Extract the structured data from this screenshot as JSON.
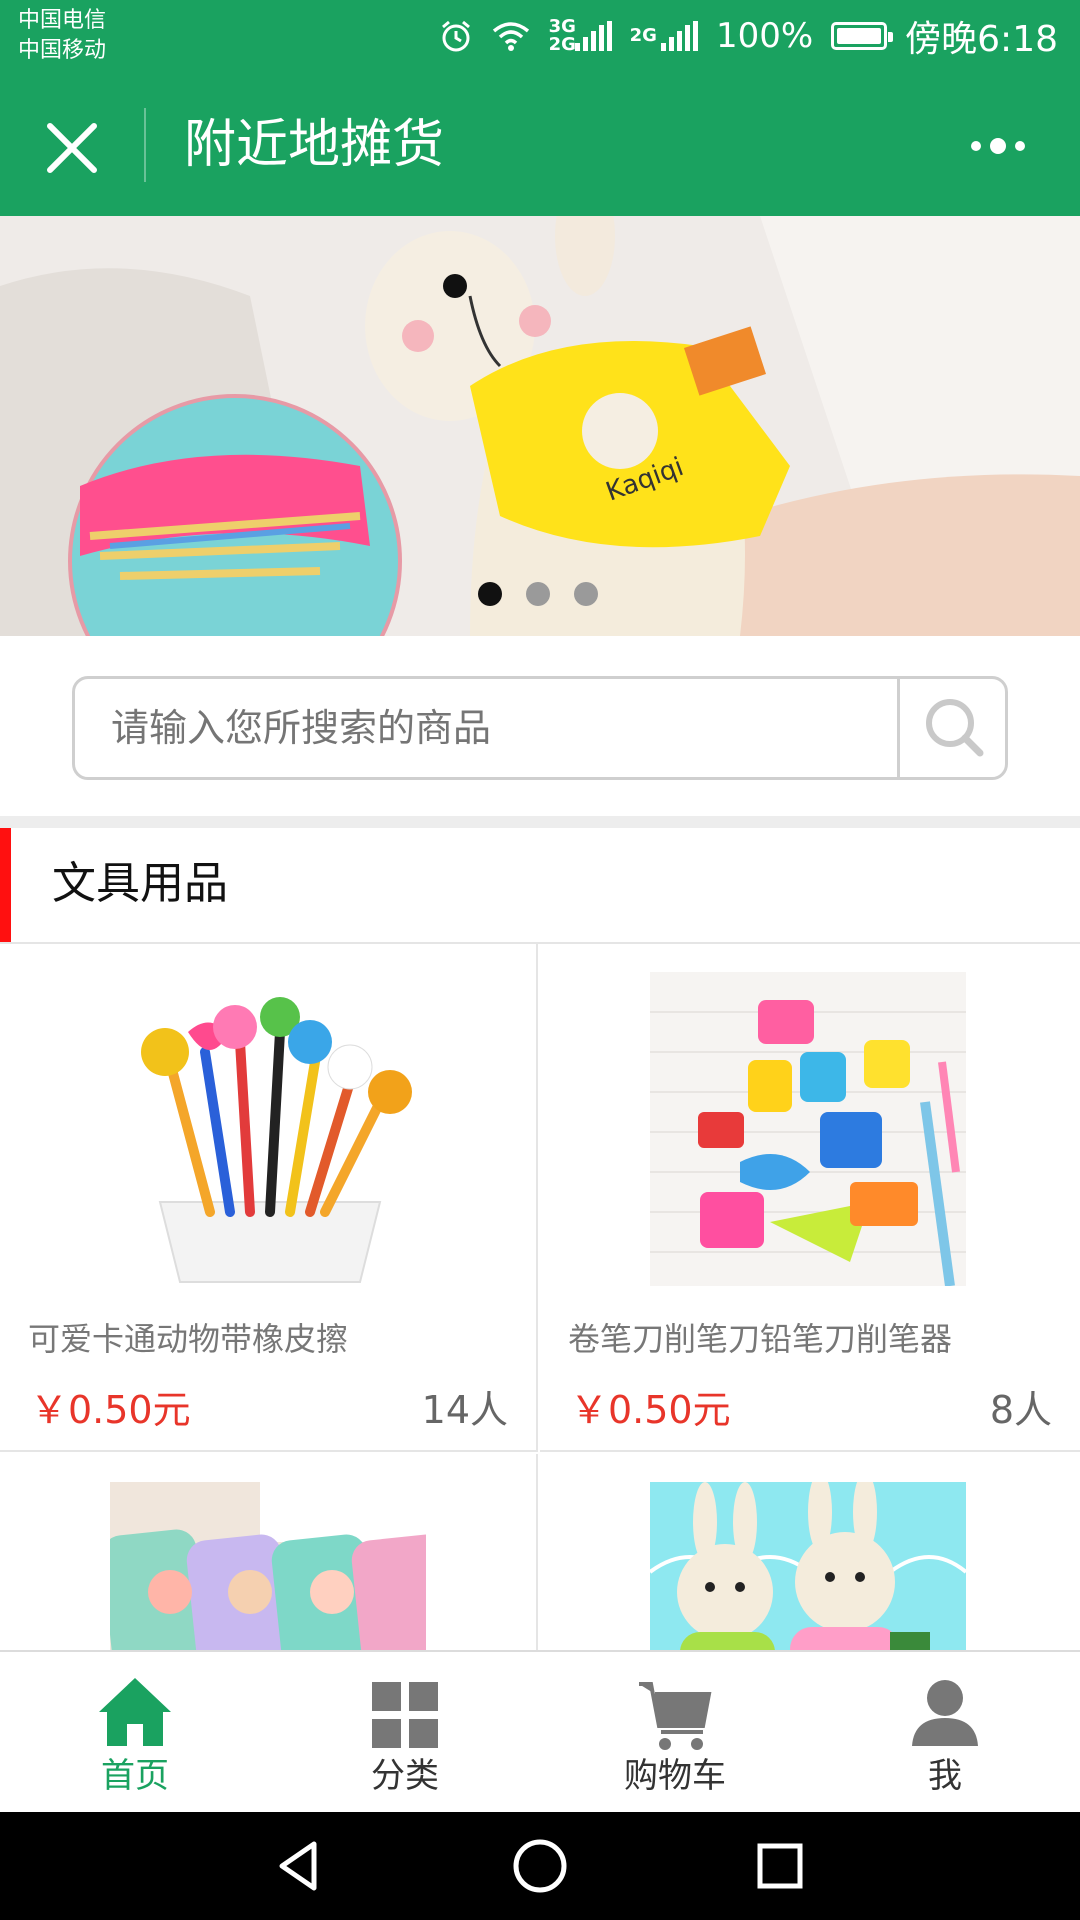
{
  "status_bar": {
    "carrier_1": "中国电信",
    "carrier_2": "中国移动",
    "net_1": "3G 2G",
    "net_2": "2G",
    "battery": "100%",
    "time": "傍晚6:18"
  },
  "nav": {
    "title": "附近地摊货",
    "close_icon": "close-icon",
    "more_icon": "more-dots-icon"
  },
  "banner": {
    "slide_count": 3,
    "active_slide": 1,
    "pillowcase_text": "Kaqiqi"
  },
  "search": {
    "placeholder": "请输入您所搜索的商品",
    "icon": "search-icon"
  },
  "section": {
    "title": "文具用品"
  },
  "products": [
    {
      "name": "可爱卡通动物带橡皮擦",
      "price": "￥0.50元",
      "buyers": "14人"
    },
    {
      "name": "卷笔刀削笔刀铅笔刀削笔器",
      "price": "￥0.50元",
      "buyers": "8人"
    },
    {
      "name": "",
      "price": "",
      "buyers": ""
    },
    {
      "name": "",
      "price": "",
      "buyers": ""
    }
  ],
  "tabs": [
    {
      "label": "首页",
      "icon": "home-icon",
      "active": true
    },
    {
      "label": "分类",
      "icon": "grid-icon",
      "active": false
    },
    {
      "label": "购物车",
      "icon": "cart-icon",
      "active": false
    },
    {
      "label": "我",
      "icon": "user-icon",
      "active": false
    }
  ],
  "colors": {
    "brand_green": "#1aa260",
    "price_red": "#e8352a",
    "section_accent": "#ff1010"
  }
}
